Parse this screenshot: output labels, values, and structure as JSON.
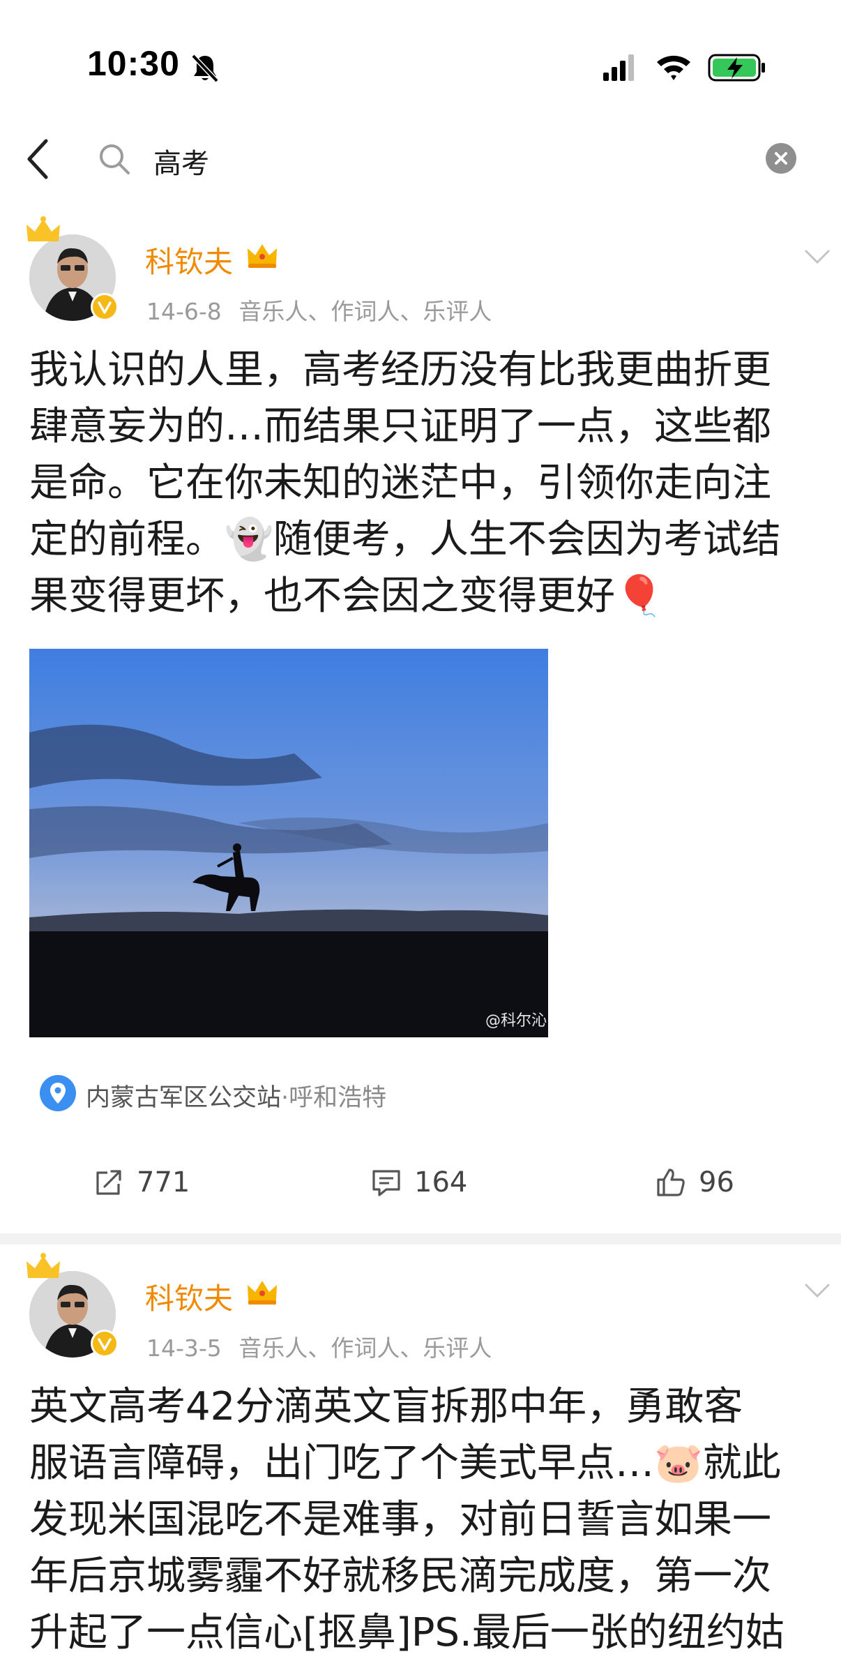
{
  "status_bar": {
    "time": "10:30"
  },
  "search": {
    "query": "高考"
  },
  "posts": [
    {
      "author": "科钦夫",
      "date": "14-6-8",
      "author_desc": "音乐人、作词人、乐评人",
      "lines": [
        "我认识的人里，高考经历没有比我更曲折更",
        "肆意妄为的…而结果只证明了一点，这些都",
        "是命。它在你未知的迷茫中，引领你走向注",
        "定的前程。👻随便考，人生不会因为考试结",
        "果变得更坏，也不会因之变得更好🎈"
      ],
      "image_watermark": "@科尔沁",
      "location": {
        "name": "内蒙古军区公交站",
        "city": "·呼和浩特"
      },
      "actions": {
        "reposts": "771",
        "comments": "164",
        "likes": "96"
      }
    },
    {
      "author": "科钦夫",
      "date": "14-3-5",
      "author_desc": "音乐人、作词人、乐评人",
      "lines": [
        "英文高考42分滴英文盲拆那中年，勇敢客",
        "服语言障碍，出门吃了个美式早点…🐷就此",
        "发现米国混吃不是难事，对前日誓言如果一",
        "年后京城雾霾不好就移民滴完成度，第一次",
        "升起了一点信心[抠鼻]PS.最后一张的纽约姑"
      ]
    }
  ],
  "colors": {
    "author": "#f08a00",
    "meta": "#9a9a9a",
    "verified": "#f5b915",
    "location_pin": "#3b8ff0"
  }
}
